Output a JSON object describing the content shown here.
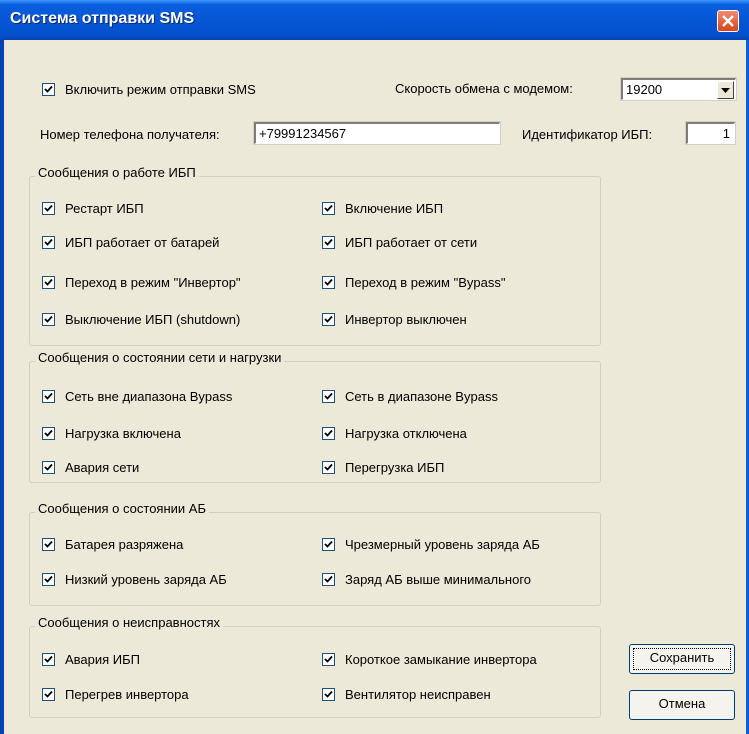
{
  "window": {
    "title": "Система отправки SMS"
  },
  "top": {
    "enable_sms_label": "Включить режим отправки SMS",
    "enable_sms_checked": true,
    "modem_speed_label": "Скорость обмена с модемом:",
    "modem_speed_value": "19200",
    "phone_label": "Номер телефона получателя:",
    "phone_value": "+79991234567",
    "ups_id_label": "Идентификатор ИБП:",
    "ups_id_value": "1"
  },
  "groups": [
    {
      "title": "Сообщения о работе ИБП",
      "items": [
        {
          "label": "Рестарт ИБП",
          "checked": true
        },
        {
          "label": "Включение ИБП",
          "checked": true
        },
        {
          "label": "ИБП работает от батарей",
          "checked": true
        },
        {
          "label": "ИБП работает от сети",
          "checked": true
        },
        {
          "label": "Переход в режим \"Инвертор\"",
          "checked": true
        },
        {
          "label": "Переход в режим \"Bypass\"",
          "checked": true
        },
        {
          "label": "Выключение ИБП (shutdown)",
          "checked": true
        },
        {
          "label": "Инвертор выключен",
          "checked": true
        }
      ]
    },
    {
      "title": "Сообщения о состоянии сети и нагрузки",
      "items": [
        {
          "label": "Сеть вне диапазона Bypass",
          "checked": true
        },
        {
          "label": "Сеть в диапазоне Bypass",
          "checked": true
        },
        {
          "label": "Нагрузка включена",
          "checked": true
        },
        {
          "label": "Нагрузка отключена",
          "checked": true
        },
        {
          "label": "Авария сети",
          "checked": true
        },
        {
          "label": "Перегрузка ИБП",
          "checked": true
        }
      ]
    },
    {
      "title": "Сообщения о состоянии АБ",
      "items": [
        {
          "label": "Батарея разряжена",
          "checked": true
        },
        {
          "label": "Чрезмерный уровень заряда АБ",
          "checked": true
        },
        {
          "label": "Низкий уровень заряда АБ",
          "checked": true
        },
        {
          "label": "Заряд АБ выше минимального",
          "checked": true
        }
      ]
    },
    {
      "title": "Сообщения о неисправностях",
      "items": [
        {
          "label": "Авария ИБП",
          "checked": true
        },
        {
          "label": "Короткое замыкание инвертора",
          "checked": true
        },
        {
          "label": "Перегрев инвертора",
          "checked": true
        },
        {
          "label": "Вентилятор неисправен",
          "checked": true
        }
      ]
    }
  ],
  "buttons": {
    "save_label": "Сохранить",
    "cancel_label": "Отмена"
  },
  "colors": {
    "titlebar": "#0556d6",
    "close_button": "#d9441e",
    "face": "#ece9d8",
    "check_border": "#1c5180"
  }
}
